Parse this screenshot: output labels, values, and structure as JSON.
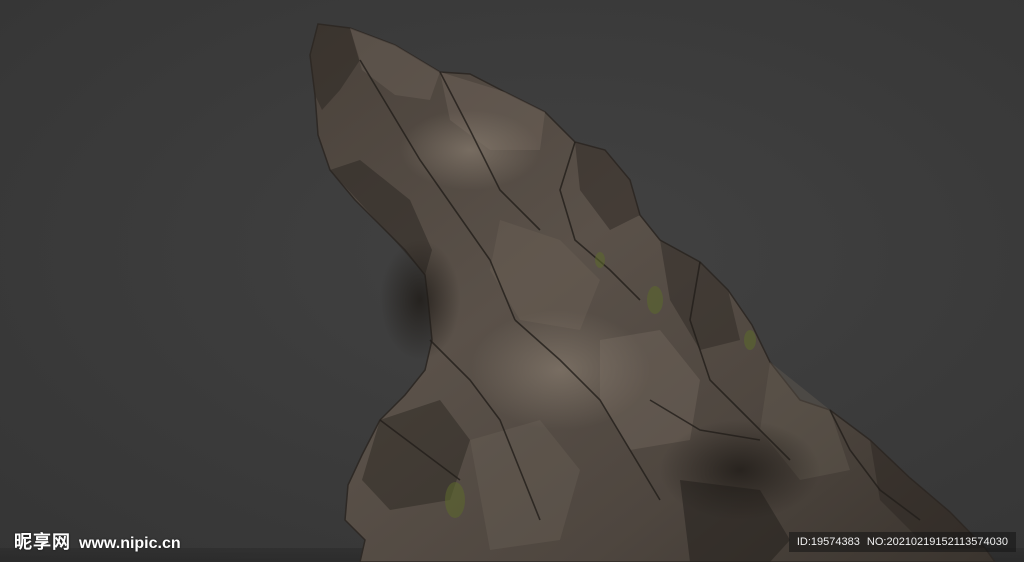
{
  "watermark": {
    "brand": "昵享网",
    "url": "www.nipic.cn",
    "id": "ID:19574383",
    "no": "NO:20210219152113574030"
  },
  "colors": {
    "background": "#3b3b3b",
    "rock_dark": "#3a342e",
    "rock_mid": "#5a5149",
    "rock_light": "#7d7368",
    "moss": "#5c6a2c"
  },
  "icons": {
    "subject": "rock-formation"
  }
}
